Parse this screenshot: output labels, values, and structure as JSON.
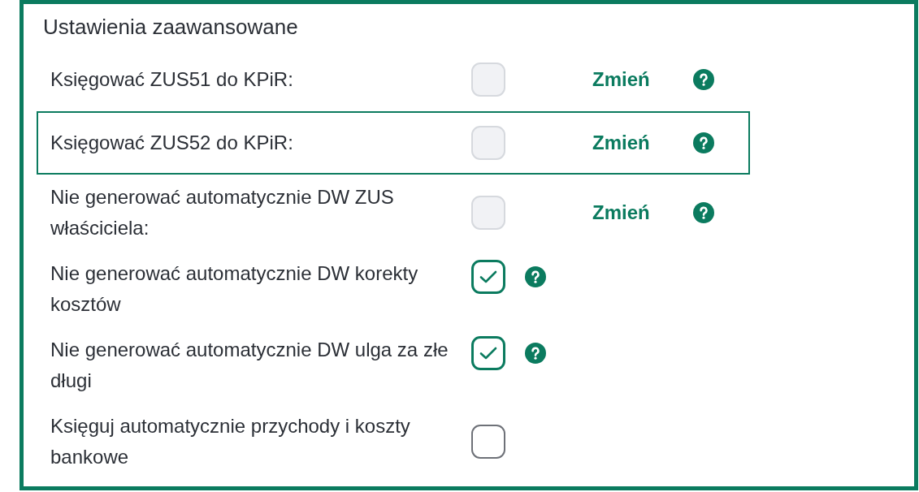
{
  "section": {
    "title": "Ustawienia zaawansowane"
  },
  "settings": [
    {
      "kind": "change",
      "label": "Księgować ZUS51 do KPiR:",
      "checked": false,
      "disabled": true,
      "focused": false,
      "action": "Zmień"
    },
    {
      "kind": "change",
      "label": "Księgować ZUS52 do KPiR:",
      "checked": false,
      "disabled": true,
      "focused": true,
      "action": "Zmień"
    },
    {
      "kind": "change",
      "label": "Nie generować automatycznie DW ZUS właściciela:",
      "checked": false,
      "disabled": true,
      "focused": false,
      "action": "Zmień"
    },
    {
      "kind": "help",
      "label": "Nie generować automatycznie DW korekty kosztów",
      "checked": true,
      "disabled": false,
      "focused": false
    },
    {
      "kind": "help",
      "label": "Nie generować automatycznie DW ulga za złe długi",
      "checked": true,
      "disabled": false,
      "focused": false
    },
    {
      "kind": "plain",
      "label": "Księguj automatycznie przychody i koszty bankowe",
      "checked": false,
      "disabled": false,
      "focused": false
    }
  ]
}
